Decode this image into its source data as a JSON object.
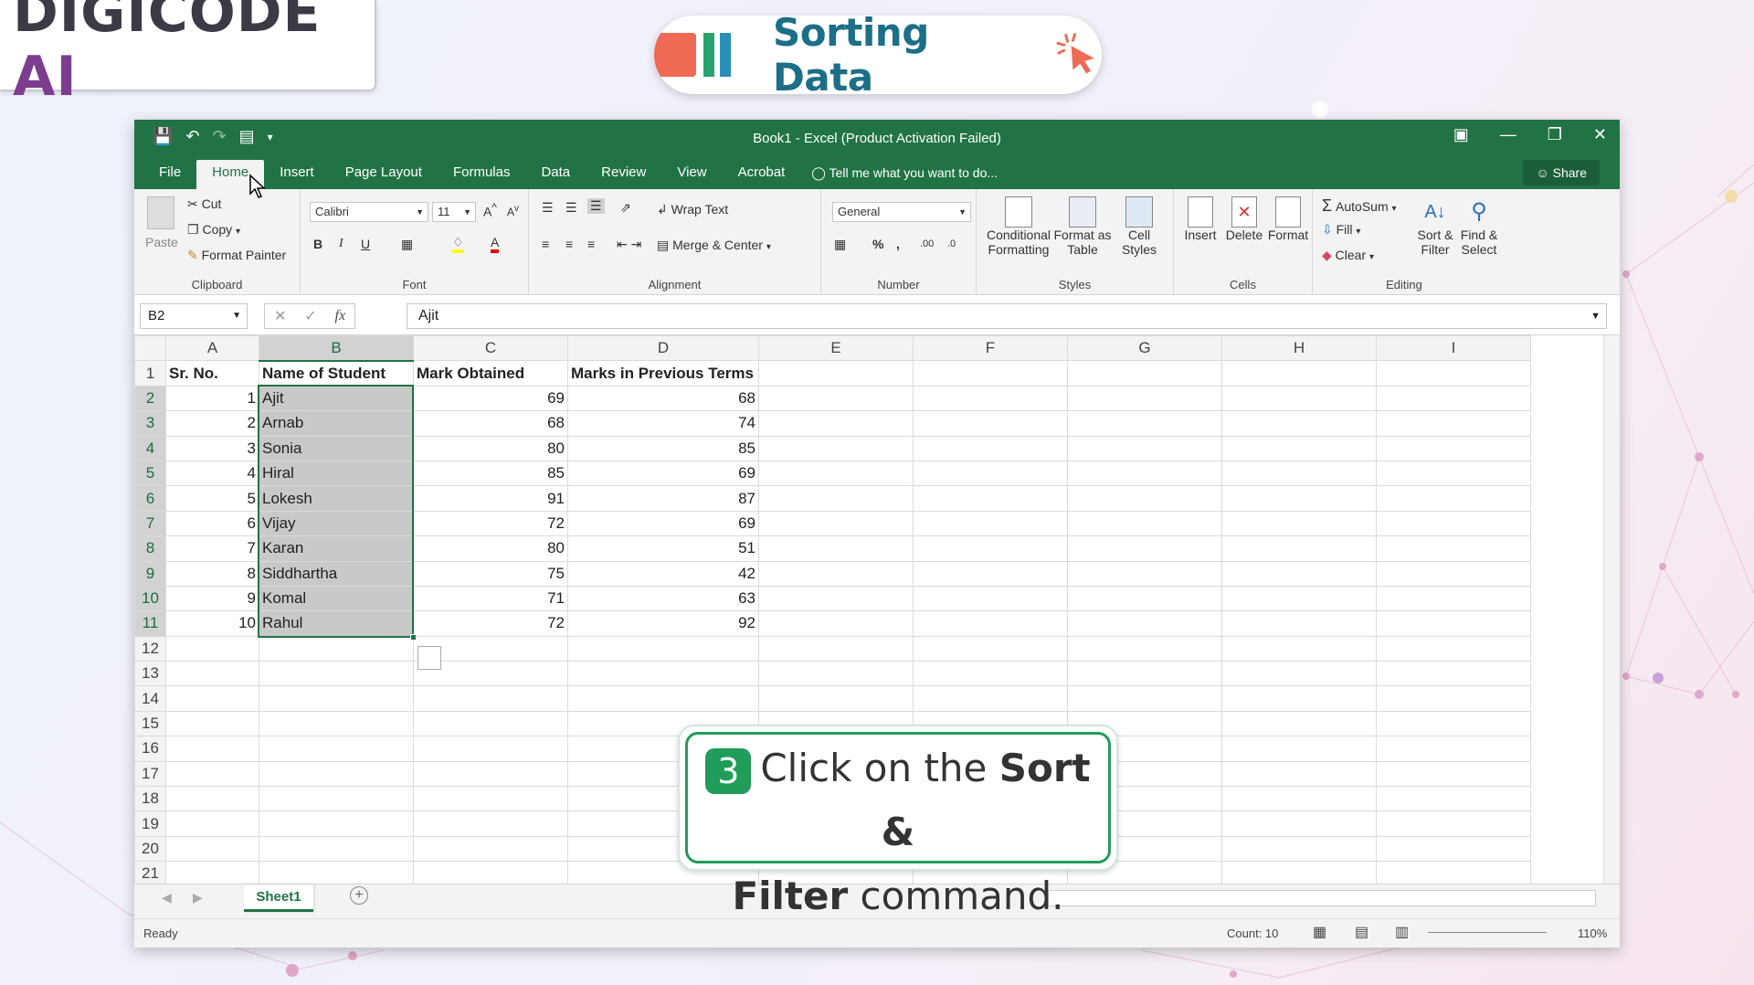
{
  "brand": {
    "text_main": "DIGICODE",
    "text_ai": "AI"
  },
  "banner": {
    "title": "Sorting Data"
  },
  "window": {
    "title": "Book1 - Excel (Product Activation Failed)"
  },
  "ribbon_tabs": [
    "File",
    "Home",
    "Insert",
    "Page Layout",
    "Formulas",
    "Data",
    "Review",
    "View",
    "Acrobat"
  ],
  "active_tab": "Home",
  "tell_me": "Tell me what you want to do...",
  "share": "Share",
  "clipboard": {
    "paste": "Paste",
    "cut": "Cut",
    "copy": "Copy",
    "format_painter": "Format Painter",
    "label": "Clipboard"
  },
  "font": {
    "name": "Calibri",
    "size": "11",
    "label": "Font",
    "bold": "B",
    "italic": "I",
    "underline": "U"
  },
  "alignment": {
    "wrap": "Wrap Text",
    "merge": "Merge & Center",
    "label": "Alignment"
  },
  "number": {
    "format": "General",
    "percent": "%",
    "comma": ",",
    "label": "Number"
  },
  "styles": {
    "conditional": "Conditional",
    "conditional2": "Formatting",
    "format_as": "Format as",
    "format_as2": "Table",
    "cell": "Cell",
    "cell2": "Styles",
    "label": "Styles"
  },
  "cells": {
    "insert": "Insert",
    "delete": "Delete",
    "format": "Format",
    "label": "Cells"
  },
  "editing": {
    "autosum": "AutoSum",
    "fill": "Fill",
    "clear": "Clear",
    "sort": "Sort &",
    "sort2": "Filter",
    "find": "Find &",
    "find2": "Select",
    "label": "Editing"
  },
  "formula_bar": {
    "name_box": "B2",
    "value": "Ajit",
    "fx": "fx"
  },
  "columns": [
    "A",
    "B",
    "C",
    "D",
    "E",
    "F",
    "G",
    "H",
    "I"
  ],
  "header_row": {
    "a": "Sr. No.",
    "b": "Name of Student",
    "c": "Mark Obtained",
    "d": "Marks in Previous Terms"
  },
  "rows": [
    {
      "a": "1",
      "b": "Ajit",
      "c": "69",
      "d": "68"
    },
    {
      "a": "2",
      "b": "Arnab",
      "c": "68",
      "d": "74"
    },
    {
      "a": "3",
      "b": "Sonia",
      "c": "80",
      "d": "85"
    },
    {
      "a": "4",
      "b": "Hiral",
      "c": "85",
      "d": "69"
    },
    {
      "a": "5",
      "b": "Lokesh",
      "c": "91",
      "d": "87"
    },
    {
      "a": "6",
      "b": "Vijay",
      "c": "72",
      "d": "69"
    },
    {
      "a": "7",
      "b": "Karan",
      "c": "80",
      "d": "51"
    },
    {
      "a": "8",
      "b": "Siddhartha",
      "c": "75",
      "d": "42"
    },
    {
      "a": "9",
      "b": "Komal",
      "c": "71",
      "d": "63"
    },
    {
      "a": "10",
      "b": "Rahul",
      "c": "72",
      "d": "92"
    }
  ],
  "row_numbers": [
    "1",
    "2",
    "3",
    "4",
    "5",
    "6",
    "7",
    "8",
    "9",
    "10",
    "11",
    "12",
    "13",
    "14",
    "15",
    "16",
    "17",
    "18",
    "19",
    "20",
    "21"
  ],
  "sheet": {
    "tab": "Sheet1"
  },
  "status": {
    "ready": "Ready",
    "count": "Count: 10",
    "zoom": "110%"
  },
  "callout": {
    "number": "3",
    "text1": "Click on the ",
    "bold1": "Sort &",
    "bold2": "Filter",
    "text2": " command."
  }
}
